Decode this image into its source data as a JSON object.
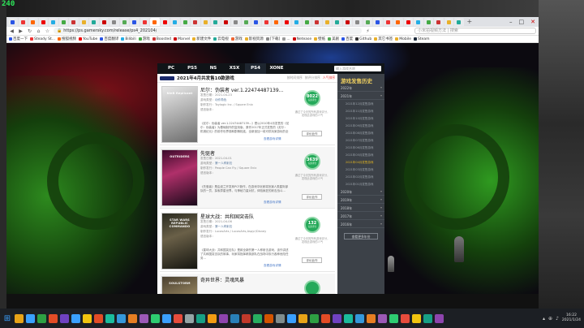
{
  "overlay": {
    "fps": "240"
  },
  "browser": {
    "tab_count": 45,
    "window_controls": [
      "–",
      "□",
      "✕"
    ],
    "url": "https://ps.gamersky.com/release/ps4_202104/",
    "search_placeholder": "小米拍视频方法 | 搜索",
    "bookmarks": [
      {
        "label": "百度一下",
        "color": "#2a55e5"
      },
      {
        "label": "Steady St...",
        "color": "#e33"
      },
      {
        "label": "搜狐视频",
        "color": "#f60"
      },
      {
        "label": "YouTube",
        "color": "#e00"
      },
      {
        "label": "百度翻译",
        "color": "#2a55e5"
      },
      {
        "label": "Bilibili",
        "color": "#23ade5"
      },
      {
        "label": "游戏",
        "color": "#4a4"
      },
      {
        "label": "Boosted",
        "color": "#c33"
      },
      {
        "label": "Marvel",
        "color": "#c00"
      },
      {
        "label": "新建文件",
        "color": "#e9b02a"
      },
      {
        "label": "云电视",
        "color": "#2a9"
      },
      {
        "label": "游戏",
        "color": "#e63"
      },
      {
        "label": "影视资源",
        "color": "#e9b02a"
      },
      {
        "label": "[下载]",
        "color": "#888"
      },
      {
        "label": "...",
        "color": "#999"
      },
      {
        "label": "Netease",
        "color": "#c00"
      },
      {
        "label": "壁纸",
        "color": "#e9b02a"
      },
      {
        "label": "美剧",
        "color": "#5a5"
      },
      {
        "label": "百度",
        "color": "#2a55e5"
      },
      {
        "label": "Github",
        "color": "#333"
      },
      {
        "label": "其它书签",
        "color": "#e9b02a"
      },
      {
        "label": "Mobile",
        "color": "#e9b02a"
      },
      {
        "label": "Steam",
        "color": "#1b2838"
      }
    ]
  },
  "site": {
    "platforms": [
      "PC",
      "PS5",
      "NS",
      "XSX",
      "PS4",
      "XONE"
    ],
    "active_platform": "PS4",
    "search_placeholder": "输入游戏名称",
    "list_title": "2021年4月共发售10款游戏",
    "sort_links": [
      "按时间排序",
      "按评分排序",
      "人气排序"
    ],
    "games": [
      {
        "title": "尼尔：伪装者 ver.1.22474487139...",
        "date": "发售日期：2021-04-23",
        "genre_label": "游戏类型：",
        "genre": "动作角色",
        "dev": "制作发行：Toylogic Inc. / Square Enix",
        "lang": "语言版本：",
        "desc": "《尼尔：伪装者 ver.1.22474487139...》是以2010年4月发售的《尼尔：伪装者》为基础制作的复刻版，原作2017年正式发售的《尼尔：机械纪元》的前作世界观和剧情相连，全新追加一段可供玩家游玩的全新剧情，增加了大量新要素...",
        "more": "查看游戏详情",
        "score": "8022",
        "score_label": "玩家评分",
        "rate_text": "通过了今天的所有游戏评分，发现此游戏的人气",
        "rate_button": "评价此作",
        "cover": "NieR Replicant"
      },
      {
        "title": "先驱者",
        "date": "发售日期：2021-04-01",
        "genre_label": "游戏类型：",
        "genre": "第一人称射击",
        "dev": "制作发行：People Can Fly / Square Enix",
        "lang": "语言版本：",
        "desc": "《先驱者》是由波兰开发商PCF新作，在游戏中玩家将扮演人类星际部队的一员，探索异星世界，与神秘力量对抗，体验疯狂的射击战斗...",
        "more": "查看游戏详情",
        "score": "3639",
        "score_label": "玩家评分",
        "rate_text": "通过了今天的所有游戏评分，发现此游戏的人气",
        "rate_button": "评价此作",
        "cover": "OUTRIDERS"
      },
      {
        "title": "星球大战：共和国突击队",
        "date": "发售日期：2021-04-06",
        "genre_label": "游戏类型：",
        "genre": "第一人称射击",
        "dev": "制作发行：LucasArts / LucasArts,Aspyr/Disney",
        "lang": "语言版本：",
        "desc": "《星球大战：共和国突击队》是款全新的第一人称射击游戏，该作讲述了共和国突击队的故事，玩家将指挥精英部队在战场中执行各种危险任务...",
        "more": "查看游戏详情",
        "score": "132",
        "score_label": "玩家评分",
        "rate_text": "通过了今天的所有游戏评分，发现此游戏的人气",
        "rate_button": "评价此作",
        "cover": "STAR WARS REPUBLIC COMMANDO"
      },
      {
        "title": "奇异世界：灵魂风暴",
        "date": "",
        "genre_label": "",
        "genre": "",
        "dev": "",
        "lang": "",
        "desc": "",
        "more": "",
        "score": "",
        "score_label": "",
        "rate_text": "",
        "rate_button": "",
        "cover": "SOULSTORM"
      }
    ],
    "sidebar": {
      "title": "游戏发售历史",
      "years_top": [
        "2022年",
        "2021年"
      ],
      "months": [
        "2021年12月发售游戏",
        "2021年11月发售游戏",
        "2021年10月发售游戏",
        "2021年09月发售游戏",
        "2021年08月发售游戏",
        "2021年07月发售游戏",
        "2021年06月发售游戏",
        "2021年05月发售游戏",
        "2021年04月发售游戏",
        "2021年03月发售游戏",
        "2021年02月发售游戏",
        "2021年01月发售游戏"
      ],
      "highlighted_month": "2021年04月发售游戏",
      "years_bottom": [
        "2020年",
        "2019年",
        "2018年",
        "2017年",
        "2016年"
      ],
      "button": "查看更多年份"
    }
  },
  "taskbar": {
    "apps": [
      "#e8a317",
      "#3aa0ff",
      "#2ea043",
      "#e34c26",
      "#6f42c1",
      "#3aa0ff",
      "#f1c40f",
      "#e34c26",
      "#1abc9c",
      "#3498db",
      "#e67e22",
      "#9b59b6",
      "#2ecc71",
      "#3aa0ff",
      "#e74c3c",
      "#95a5a6",
      "#16a085",
      "#f39c12",
      "#8e44ad",
      "#2980b9",
      "#c0392b",
      "#27ae60",
      "#d35400",
      "#7f8c8d",
      "#3aa0ff",
      "#e8a317",
      "#2ea043",
      "#e34c26",
      "#6f42c1",
      "#1abc9c",
      "#3498db",
      "#e67e22",
      "#9b59b6",
      "#2ecc71",
      "#e74c3c",
      "#f1c40f",
      "#16a085",
      "#8e44ad"
    ],
    "time": "16:22",
    "date": "2021/1/24"
  }
}
